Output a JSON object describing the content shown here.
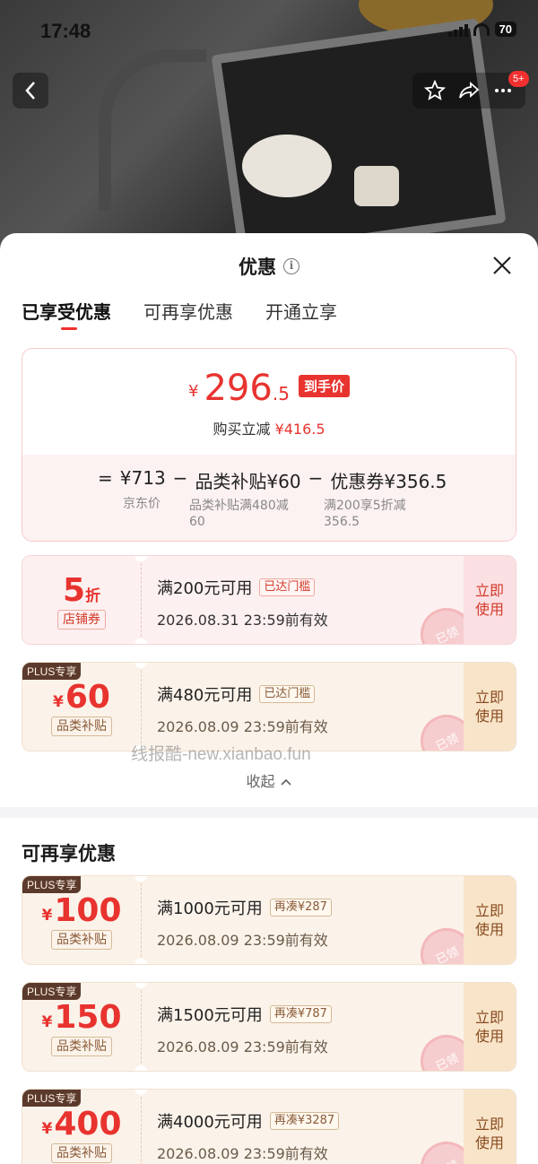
{
  "status_bar": {
    "time": "17:48",
    "battery": "70"
  },
  "nav": {
    "badge": "5+"
  },
  "sheet": {
    "title": "优惠",
    "tabs": [
      {
        "label": "已享受优惠"
      },
      {
        "label": "可再享优惠"
      },
      {
        "label": "开通立享"
      }
    ],
    "summary": {
      "currency": "¥",
      "price_int": "296",
      "price_dec": ".5",
      "price_tag": "到手价",
      "saving_label": "购买立减",
      "saving_amount": "¥416.5",
      "formula": {
        "eq": "=",
        "jd_price": "¥713",
        "minus1": "−",
        "subsidy": "品类补贴¥60",
        "minus2": "−",
        "coupon": "优惠券¥356.5",
        "jd_price_label": "京东价",
        "subsidy_desc": "品类补贴满480减60",
        "coupon_desc": "满200享5折减356.5"
      }
    },
    "enjoyed_coupons": [
      {
        "value": "5",
        "unit": "折",
        "type": "店铺券",
        "condition": "满200元可用",
        "badge": "已达门槛",
        "expiry": "2026.08.31 23:59前有效",
        "action": "立即使用",
        "stamp": "已领"
      },
      {
        "plus": "PLUS专享",
        "currency": "¥",
        "value": "60",
        "type": "品类补贴",
        "condition": "满480元可用",
        "badge": "已达门槛",
        "expiry": "2026.08.09 23:59前有效",
        "action": "立即使用",
        "stamp": "已领"
      }
    ],
    "collapse_label": "收起",
    "more_section_title": "可再享优惠",
    "more_coupons": [
      {
        "plus": "PLUS专享",
        "currency": "¥",
        "value": "100",
        "type": "品类补贴",
        "condition": "满1000元可用",
        "badge": "再凑¥287",
        "expiry": "2026.08.09 23:59前有效",
        "action": "立即使用",
        "stamp": "已领"
      },
      {
        "plus": "PLUS专享",
        "currency": "¥",
        "value": "150",
        "type": "品类补贴",
        "condition": "满1500元可用",
        "badge": "再凑¥787",
        "expiry": "2026.08.09 23:59前有效",
        "action": "立即使用",
        "stamp": "已领"
      },
      {
        "plus": "PLUS专享",
        "currency": "¥",
        "value": "400",
        "type": "品类补贴",
        "condition": "满4000元可用",
        "badge": "再凑¥3287",
        "expiry": "2026.08.09 23:59前有效",
        "action": "立即使用",
        "stamp": "已领"
      }
    ]
  },
  "watermark": "线报酷-new.xianbao.fun",
  "colors": {
    "accent_red": "#e8332f",
    "plus_brown": "#5b3a2c",
    "pink_bg": "#fdf0f0",
    "beige_bg": "#fbf3ea"
  }
}
